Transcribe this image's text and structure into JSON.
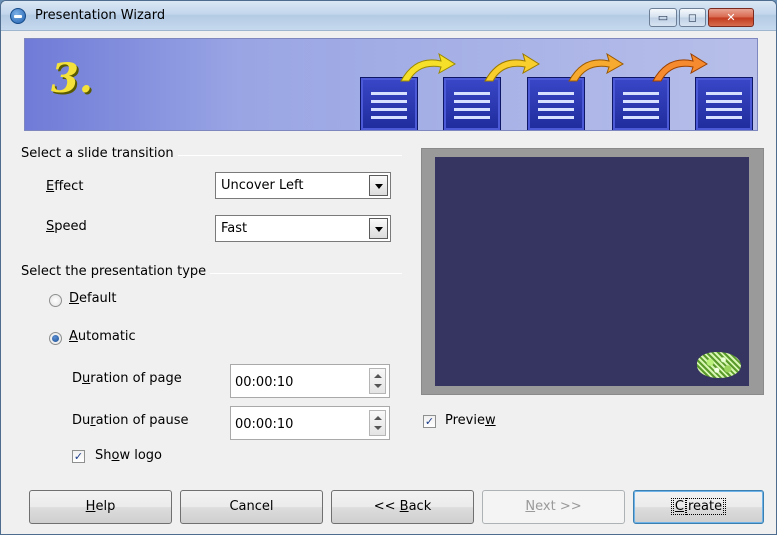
{
  "window": {
    "title": "Presentation Wizard",
    "controls": {
      "minimize": "▭",
      "maximize": "◻",
      "close": "✕"
    }
  },
  "banner": {
    "step_number": "3."
  },
  "transition": {
    "group_label": "Select a slide transition",
    "effect_label_accel": "E",
    "effect_label_rest": "ffect",
    "effect_value": "Uncover Left",
    "speed_label_accel": "S",
    "speed_label_rest": "peed",
    "speed_value": "Fast"
  },
  "presentation_type": {
    "group_label": "Select the presentation type",
    "default_accel": "D",
    "default_rest": "efault",
    "default_selected": false,
    "automatic_accel": "A",
    "automatic_rest": "utomatic",
    "automatic_selected": true,
    "duration_page_pre": "D",
    "duration_page_accel": "u",
    "duration_page_rest": "ration of page",
    "duration_page_value": "00:00:10",
    "duration_pause_pre": "Du",
    "duration_pause_accel": "r",
    "duration_pause_rest": "ation of pause",
    "duration_pause_value": "00:00:10",
    "show_logo_pre": "Sh",
    "show_logo_accel": "o",
    "show_logo_rest": "w logo",
    "show_logo_checked": true
  },
  "preview": {
    "checkbox_pre": "Previe",
    "checkbox_accel": "w",
    "checked": true
  },
  "buttons": {
    "help_accel": "H",
    "help_rest": "elp",
    "cancel": "Cancel",
    "back_pre": "<< ",
    "back_accel": "B",
    "back_rest": "ack",
    "next_accel": "N",
    "next_rest": "ext >>",
    "create_accel": "C",
    "create_rest": "reate"
  },
  "colors": {
    "banner_start": "#6f7bd7",
    "preview_slide": "#363562",
    "step_number": "#f4e23a"
  }
}
